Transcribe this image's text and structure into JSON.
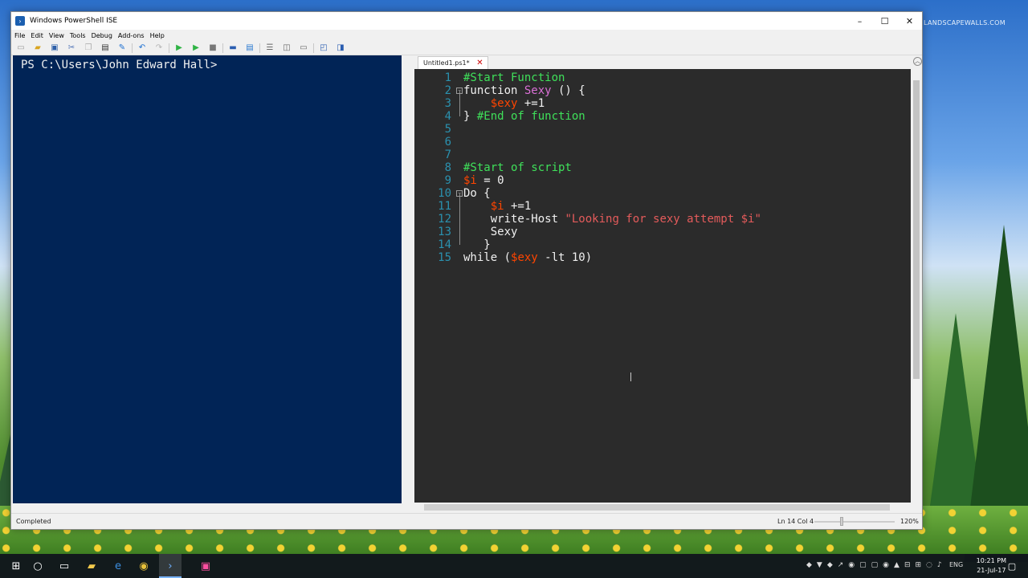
{
  "wallpaper": {
    "watermark": "LANDSCAPEWALLS.COM"
  },
  "window": {
    "title": "Windows PowerShell ISE",
    "controls": {
      "minimize": "–",
      "maximize": "☐",
      "close": "✕"
    }
  },
  "menu": [
    "File",
    "Edit",
    "View",
    "Tools",
    "Debug",
    "Add-ons",
    "Help"
  ],
  "toolbar": {
    "icons": [
      "new-file-icon",
      "open-folder-icon",
      "save-icon",
      "cut-icon",
      "copy-icon",
      "paste-icon",
      "clear-console-icon",
      "undo-icon",
      "redo-icon",
      "run-script-icon",
      "run-selection-icon",
      "stop-icon",
      "new-remote-tab-icon",
      "start-powershell-icon",
      "show-script-pane-top-icon",
      "show-script-pane-right-icon",
      "show-script-pane-max-icon",
      "show-command-window-icon",
      "show-command-addon-icon"
    ]
  },
  "console": {
    "prompt": "PS C:\\Users\\John Edward Hall>"
  },
  "editor": {
    "tab": {
      "label": "Untitled1.ps1*",
      "close": "✕"
    },
    "lines": [
      {
        "n": "1",
        "tokens": [
          [
            "c-comment",
            "#Start Function"
          ]
        ]
      },
      {
        "n": "2",
        "tokens": [
          [
            "c-plain",
            "function "
          ],
          [
            "c-func",
            "Sexy"
          ],
          [
            "c-plain",
            " () {"
          ]
        ]
      },
      {
        "n": "3",
        "tokens": [
          [
            "c-plain",
            "    "
          ],
          [
            "c-var",
            "$exy"
          ],
          [
            "c-plain",
            " +=1"
          ]
        ]
      },
      {
        "n": "4",
        "tokens": [
          [
            "c-plain",
            "} "
          ],
          [
            "c-comment",
            "#End of function"
          ]
        ]
      },
      {
        "n": "5",
        "tokens": []
      },
      {
        "n": "6",
        "tokens": []
      },
      {
        "n": "7",
        "tokens": []
      },
      {
        "n": "8",
        "tokens": [
          [
            "c-comment",
            "#Start of script"
          ]
        ]
      },
      {
        "n": "9",
        "tokens": [
          [
            "c-var",
            "$i"
          ],
          [
            "c-plain",
            " = 0"
          ]
        ]
      },
      {
        "n": "10",
        "tokens": [
          [
            "c-plain",
            "Do {"
          ]
        ]
      },
      {
        "n": "11",
        "tokens": [
          [
            "c-plain",
            "    "
          ],
          [
            "c-var",
            "$i"
          ],
          [
            "c-plain",
            " +=1"
          ]
        ]
      },
      {
        "n": "12",
        "tokens": [
          [
            "c-plain",
            "    write-Host "
          ],
          [
            "c-str",
            "\"Looking for sexy attempt $i\""
          ]
        ]
      },
      {
        "n": "13",
        "tokens": [
          [
            "c-plain",
            "    Sexy"
          ]
        ]
      },
      {
        "n": "14",
        "tokens": [
          [
            "c-plain",
            "   }"
          ]
        ]
      },
      {
        "n": "15",
        "tokens": [
          [
            "c-plain",
            "while ("
          ],
          [
            "c-var",
            "$exy"
          ],
          [
            "c-plain",
            " -lt 10)"
          ]
        ]
      }
    ]
  },
  "status": {
    "text": "Completed",
    "position": "Ln 14  Col 4",
    "zoom": "120%"
  },
  "taskbar": {
    "clock_time": "10:21 PM",
    "clock_date": "21-Jul-17",
    "language": "ENG"
  },
  "colors": {
    "console_bg": "#012456",
    "editor_bg": "#2b2b2b",
    "comment": "#3fe05a",
    "variable": "#ff4500",
    "function": "#da70d6",
    "string": "#e45b5b",
    "line_number": "#2b91af"
  }
}
